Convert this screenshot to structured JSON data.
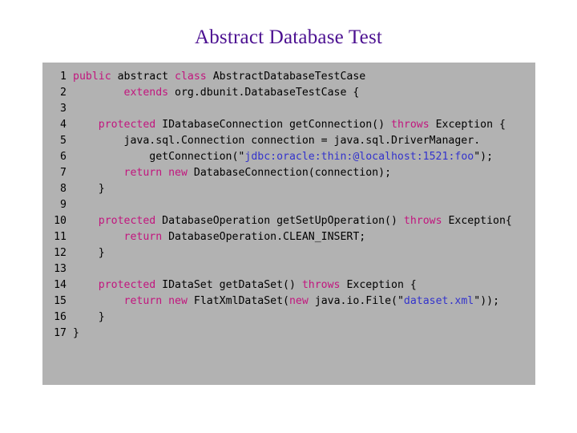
{
  "slide": {
    "title": "Abstract Database Test",
    "title_color": "#4c1191",
    "panel_background": "#b2b2b2",
    "keyword_color": "#c2157e",
    "string_color": "#3333cc",
    "text_color": "#000000"
  },
  "code": {
    "language": "java",
    "line_numbers": [
      "1",
      "2",
      "3",
      "4",
      "5",
      "6",
      "7",
      "8",
      "9",
      "10",
      "11",
      "12",
      "13",
      "14",
      "15",
      "16",
      "17"
    ],
    "lines": [
      {
        "number": "1",
        "text": "public abstract class AbstractDatabaseTestCase",
        "tokens": [
          {
            "t": "kw",
            "v": "public"
          },
          {
            "t": "plain",
            "v": " abstract "
          },
          {
            "t": "kw",
            "v": "class"
          },
          {
            "t": "plain",
            "v": " AbstractDatabaseTestCase"
          }
        ]
      },
      {
        "number": "2",
        "text": "        extends org.dbunit.DatabaseTestCase {",
        "tokens": [
          {
            "t": "plain",
            "v": "        "
          },
          {
            "t": "kw",
            "v": "extends"
          },
          {
            "t": "plain",
            "v": " org.dbunit.DatabaseTestCase {"
          }
        ]
      },
      {
        "number": "3",
        "text": "",
        "tokens": []
      },
      {
        "number": "4",
        "text": "    protected IDatabaseConnection getConnection() throws Exception {",
        "tokens": [
          {
            "t": "plain",
            "v": "    "
          },
          {
            "t": "kw",
            "v": "protected"
          },
          {
            "t": "plain",
            "v": " IDatabaseConnection getConnection() "
          },
          {
            "t": "kw",
            "v": "throws"
          },
          {
            "t": "plain",
            "v": " Exception {"
          }
        ]
      },
      {
        "number": "5",
        "text": "        java.sql.Connection connection = java.sql.DriverManager.",
        "tokens": [
          {
            "t": "plain",
            "v": "        java.sql.Connection connection = java.sql.DriverManager."
          }
        ]
      },
      {
        "number": "6",
        "text": "            getConnection(\"jdbc:oracle:thin:@localhost:1521:foo\");",
        "tokens": [
          {
            "t": "plain",
            "v": "            getConnection(\""
          },
          {
            "t": "str",
            "v": "jdbc:oracle:thin:@localhost:1521:foo"
          },
          {
            "t": "plain",
            "v": "\");"
          }
        ]
      },
      {
        "number": "7",
        "text": "        return new DatabaseConnection(connection);",
        "tokens": [
          {
            "t": "plain",
            "v": "        "
          },
          {
            "t": "kw",
            "v": "return new"
          },
          {
            "t": "plain",
            "v": " DatabaseConnection(connection);"
          }
        ]
      },
      {
        "number": "8",
        "text": "    }",
        "tokens": [
          {
            "t": "plain",
            "v": "    }"
          }
        ]
      },
      {
        "number": "9",
        "text": "",
        "tokens": []
      },
      {
        "number": "10",
        "text": "    protected DatabaseOperation getSetUpOperation() throws Exception{",
        "tokens": [
          {
            "t": "plain",
            "v": "    "
          },
          {
            "t": "kw",
            "v": "protected"
          },
          {
            "t": "plain",
            "v": " DatabaseOperation getSetUpOperation() "
          },
          {
            "t": "kw",
            "v": "throws"
          },
          {
            "t": "plain",
            "v": " Exception{"
          }
        ]
      },
      {
        "number": "11",
        "text": "        return DatabaseOperation.CLEAN_INSERT;",
        "tokens": [
          {
            "t": "plain",
            "v": "        "
          },
          {
            "t": "kw",
            "v": "return"
          },
          {
            "t": "plain",
            "v": " DatabaseOperation.CLEAN_INSERT;"
          }
        ]
      },
      {
        "number": "12",
        "text": "    }",
        "tokens": [
          {
            "t": "plain",
            "v": "    }"
          }
        ]
      },
      {
        "number": "13",
        "text": "",
        "tokens": []
      },
      {
        "number": "14",
        "text": "    protected IDataSet getDataSet() throws Exception {",
        "tokens": [
          {
            "t": "plain",
            "v": "    "
          },
          {
            "t": "kw",
            "v": "protected"
          },
          {
            "t": "plain",
            "v": " IDataSet getDataSet() "
          },
          {
            "t": "kw",
            "v": "throws"
          },
          {
            "t": "plain",
            "v": " Exception {"
          }
        ]
      },
      {
        "number": "15",
        "text": "        return new FlatXmlDataSet(new java.io.File(\"dataset.xml\"));",
        "tokens": [
          {
            "t": "plain",
            "v": "        "
          },
          {
            "t": "kw",
            "v": "return new"
          },
          {
            "t": "plain",
            "v": " FlatXmlDataSet("
          },
          {
            "t": "kw",
            "v": "new"
          },
          {
            "t": "plain",
            "v": " java.io.File(\""
          },
          {
            "t": "str",
            "v": "dataset.xml"
          },
          {
            "t": "plain",
            "v": "\"));"
          }
        ]
      },
      {
        "number": "16",
        "text": "    }",
        "tokens": [
          {
            "t": "plain",
            "v": "    }"
          }
        ]
      },
      {
        "number": "17",
        "text": "}",
        "tokens": [
          {
            "t": "plain",
            "v": "}"
          }
        ]
      }
    ]
  }
}
